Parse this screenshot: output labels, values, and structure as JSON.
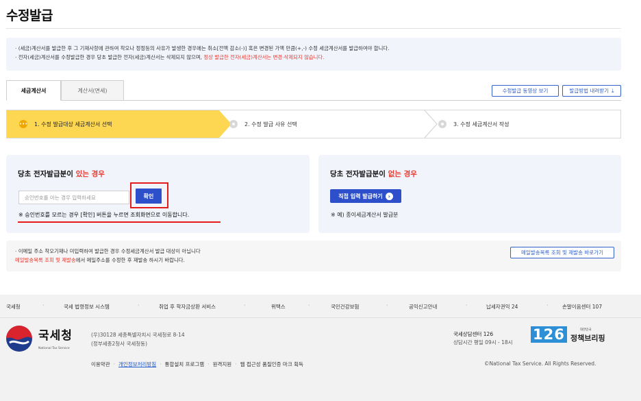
{
  "page": {
    "title": "수정발급"
  },
  "notice": {
    "line1": "· (세금)계산서를 발급한 후 그 기재사항에 관하여 착오나 정정등의 사유가 발생한 경우에는 취소[전액 감소(-)] 혹은 변경된 가액 만큼(+,-) 수정 세금계산서를 발급하여야 합니다.",
    "line2_prefix": "· 전자(세금)계산서를 수정발급한 경우 당초 발급한 전자(세금)계산서는 삭제되지 않으며, ",
    "line2_highlight": "정상 발급한 전자(세금)계산서는 변경·삭제되지 않습니다."
  },
  "tabs": [
    {
      "label": "세금계산서",
      "active": true
    },
    {
      "label": "계산서(면세)",
      "active": false
    }
  ],
  "top_buttons": {
    "video": "수정발급 동영상 보기",
    "download": "발급방법 내려받기",
    "download_icon": "download-icon"
  },
  "steps": [
    {
      "label": "1. 수정 발급대상 세금계산서 선택",
      "active": true
    },
    {
      "label": "2. 수정 발급 사유 선택",
      "active": false
    },
    {
      "label": "3. 수정 세금계산서 작성",
      "active": false
    }
  ],
  "left_box": {
    "title_prefix": "당초 전자발급분이 ",
    "title_highlight": "있는 경우",
    "input_placeholder": "승인번호를 아는 경우 입력하세요",
    "confirm_label": "확인",
    "note": "※ 승인번호를 모르는 경우 [확인] 버튼을 누르면 조회화면으로 이동합니다."
  },
  "right_box": {
    "title_prefix": "당초 전자발급분이 ",
    "title_highlight": "없는 경우",
    "button_label": "직접 입력 발급하기",
    "button_icon": "arrow-right-circle-icon",
    "note": "※ 예) 종이세금계산서 발급분"
  },
  "email_notice": {
    "line1": "· 이메일 주소 착오기재나 미입력하여 발급한 경우 수정세금계산서 발급 대상이 아닙니다",
    "line2_highlight": "메일발송목록 조회 및 재발송",
    "line2_suffix": "에서 메일주소를 수정한 후 재발송 하시기 바랍니다.",
    "button_label": "메일발송목록 조회 및 재발송 바로가기"
  },
  "footer": {
    "links": [
      "국세청",
      "국세 법령정보 시스템",
      "취업 후 학자금상환 서비스",
      "위택스",
      "국민건강보험",
      "공익신고안내",
      "납세자권익 24",
      "손말이음센터 107"
    ],
    "logo_name": "국세청",
    "logo_sub": "National Tax Service",
    "address_line1": "(우)30128 세종특별자치시 국세청로 8-14",
    "address_line2": "(정부세종2청사 국세청동)",
    "bottom_links": [
      "이용약관",
      "개인정보처리방침",
      "통합설치 프로그램",
      "원격지원",
      "웹 접근성 품질인증 마크 획득"
    ],
    "counsel_title": "국세상담센터 126",
    "counsel_hours": "상담시간 평일 09시 - 18시",
    "counsel_number": "126",
    "policy_small": "대한민국",
    "policy_big": "정책브리핑",
    "copyright": "©National Tax Service. All Rights Reserved."
  },
  "colors": {
    "primary_blue": "#2d4fc9",
    "step_active": "#fdd652",
    "highlight_red": "#e8382f",
    "annotation_red": "#e31b1b"
  }
}
